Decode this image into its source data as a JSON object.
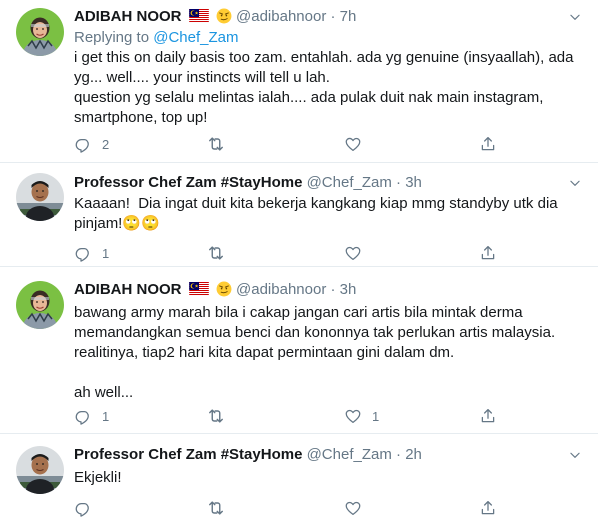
{
  "tweets": [
    {
      "name": "ADIBAH NOOR",
      "handle": "@adibahnoor",
      "dot": "·",
      "time": "7h",
      "replying_prefix": "Replying to",
      "replying_to": "@Chef_Zam",
      "text": "i get this on daily basis too zam. entahlah. ada yg genuine (insyaallah), ada yg... well.... your instincts will tell u lah.\nquestion yg selalu melintas ialah.... ada pulak duit nak main instagram, smartphone, top up!",
      "reply_count": "2",
      "retweet_count": "",
      "like_count": ""
    },
    {
      "name": "Professor Chef Zam #StayHome",
      "handle": "@Chef_Zam",
      "dot": "·",
      "time": "3h",
      "text": "Kaaaan!  Dia ingat duit kita bekerja kangkang kiap mmg standyby utk dia pinjam!🙄🙄",
      "reply_count": "1",
      "retweet_count": "",
      "like_count": ""
    },
    {
      "name": "ADIBAH NOOR",
      "handle": "@adibahnoor",
      "dot": "·",
      "time": "3h",
      "text": "bawang army marah bila i cakap jangan cari artis bila mintak derma memandangkan semua benci dan kononnya tak perlukan artis malaysia. realitinya, tiap2 hari kita dapat permintaan gini dalam dm.\n\nah well...",
      "reply_count": "1",
      "retweet_count": "",
      "like_count": "1"
    },
    {
      "name": "Professor Chef Zam #StayHome",
      "handle": "@Chef_Zam",
      "dot": "·",
      "time": "2h",
      "text": "Ekjekli!",
      "reply_count": "",
      "retweet_count": "",
      "like_count": ""
    }
  ],
  "icons": {
    "reply": "reply-icon",
    "retweet": "retweet-icon",
    "like": "heart-icon",
    "share": "share-icon",
    "more": "chevron-down-icon",
    "flag": "malaysia-flag-icon",
    "emoji": "smirking-face-icon"
  },
  "colors": {
    "icon_gray": "#657786",
    "link_blue": "#1b95e0",
    "divider": "#e6ecf0",
    "avatar1_bg": "#7bc043",
    "avatar2_bg": "#d9dde0"
  }
}
